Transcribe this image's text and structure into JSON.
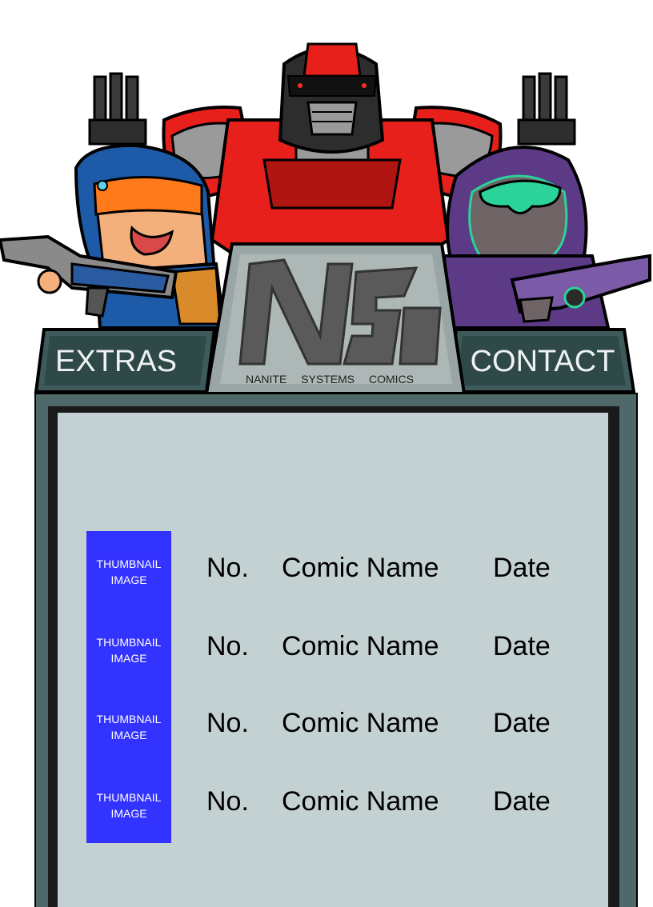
{
  "header": {
    "nav_left": "EXTRAS",
    "nav_right": "CONTACT",
    "logo_text": "NANITE SYSTEMS COMICS",
    "logo_mark": "NSC"
  },
  "archive": {
    "rows": [
      {
        "thumbnail": "THUMBNAIL IMAGE",
        "number": "No.",
        "name": "Comic Name",
        "date": "Date"
      },
      {
        "thumbnail": "THUMBNAIL IMAGE",
        "number": "No.",
        "name": "Comic Name",
        "date": "Date"
      },
      {
        "thumbnail": "THUMBNAIL IMAGE",
        "number": "No.",
        "name": "Comic Name",
        "date": "Date"
      },
      {
        "thumbnail": "THUMBNAIL IMAGE",
        "number": "No.",
        "name": "Comic Name",
        "date": "Date"
      }
    ]
  },
  "colors": {
    "panel_bg": "#c4d1d2",
    "frame": "#4f6868",
    "thumbnail_placeholder": "#3333ff",
    "robot_red": "#e8201c",
    "left_hero_blue": "#1d5aa8",
    "right_hero_purple": "#5c3a86"
  }
}
